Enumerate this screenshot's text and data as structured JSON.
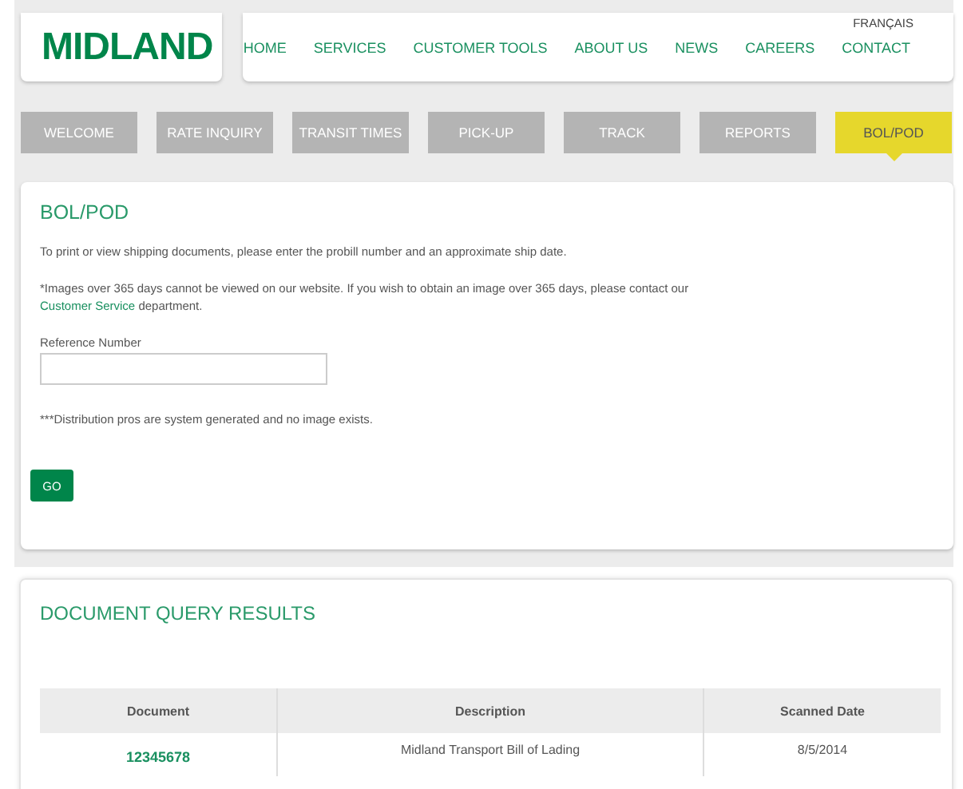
{
  "logo": {
    "text": "MIDLAND"
  },
  "language_link": "FRANÇAIS",
  "nav": [
    "HOME",
    "SERVICES",
    "CUSTOMER TOOLS",
    "ABOUT US",
    "NEWS",
    "CAREERS",
    "CONTACT"
  ],
  "tabs": [
    {
      "label": "WELCOME",
      "selected": false
    },
    {
      "label": "RATE INQUIRY",
      "selected": false
    },
    {
      "label": "TRANSIT TIMES",
      "selected": false
    },
    {
      "label": "PICK-UP",
      "selected": false
    },
    {
      "label": "TRACK",
      "selected": false
    },
    {
      "label": "REPORTS",
      "selected": false
    },
    {
      "label": "BOL/POD",
      "selected": true
    }
  ],
  "form": {
    "title": "BOL/POD",
    "intro": "To print or view shipping documents, please enter the probill number and an approximate ship date.",
    "notice_before": "*Images over 365 days cannot be viewed on our website. If you wish to obtain an image over 365 days, please contact our",
    "notice_link": "Customer Service",
    "notice_after": "department.",
    "field_label": "Reference Number",
    "footnote": "***Distribution pros are system generated and no image exists.",
    "button": "GO"
  },
  "results": {
    "title": "DOCUMENT QUERY RESULTS",
    "columns": [
      "Document",
      "Description",
      "Scanned Date"
    ],
    "rows": [
      {
        "document": "12345678",
        "description": "Midland Transport Bill of Lading",
        "scanned_date": "8/5/2014"
      }
    ]
  }
}
